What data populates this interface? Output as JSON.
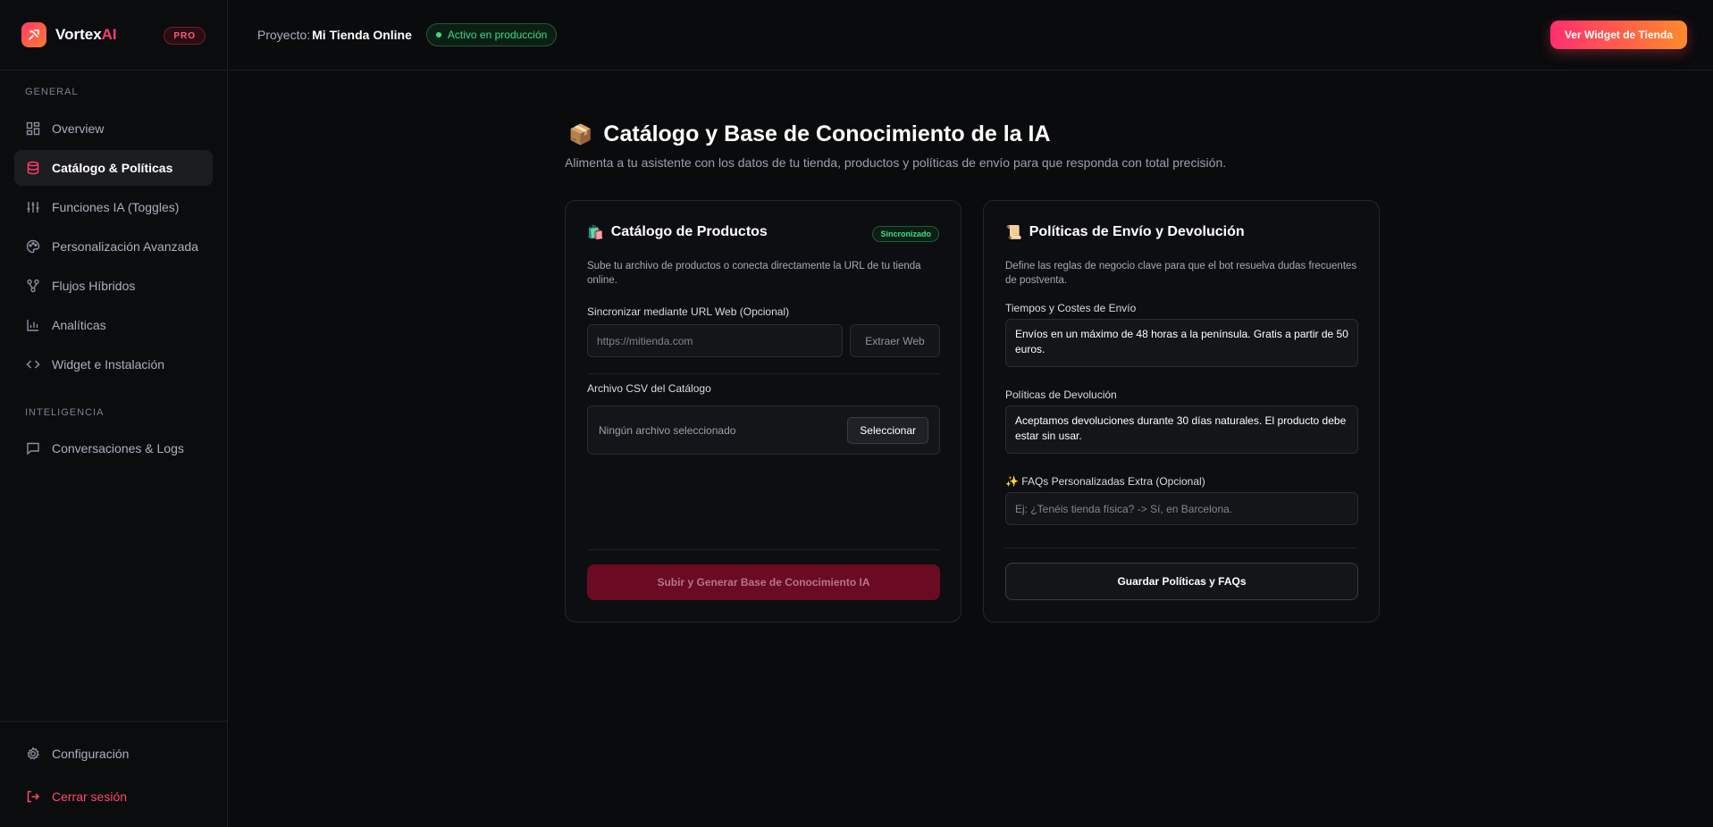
{
  "brand": {
    "name_main": "Vortex",
    "name_accent": "AI",
    "plan_badge": "PRO"
  },
  "sidebar": {
    "section_general": "GENERAL",
    "general_items": [
      {
        "label": "Overview",
        "icon": "grid-icon"
      },
      {
        "label": "Catálogo & Políticas",
        "icon": "database-icon"
      },
      {
        "label": "Funciones IA (Toggles)",
        "icon": "sliders-icon"
      },
      {
        "label": "Personalización Avanzada",
        "icon": "palette-icon"
      },
      {
        "label": "Flujos Híbridos",
        "icon": "flow-icon"
      },
      {
        "label": "Analíticas",
        "icon": "bar-chart-icon"
      },
      {
        "label": "Widget e Instalación",
        "icon": "code-icon"
      }
    ],
    "section_intel": "INTELIGENCIA",
    "intel_items": [
      {
        "label": "Conversaciones & Logs",
        "icon": "chat-icon"
      }
    ],
    "settings_label": "Configuración",
    "logout_label": "Cerrar sesión",
    "active_color": "#ff3d6b"
  },
  "topbar": {
    "project_label": "Proyecto:",
    "project_name": "Mi Tienda Online",
    "status": "Activo en producción",
    "cta": "Ver Widget de Tienda"
  },
  "page": {
    "title_emoji": "📦",
    "title": "Catálogo y Base de Conocimiento de la IA",
    "subtitle": "Alimenta a tu asistente con los datos de tu tienda, productos y políticas de envío para que responda con total precisión."
  },
  "catalog_card": {
    "emoji": "🛍️",
    "title": "Catálogo de Productos",
    "badge": "Sincronizado",
    "description": "Sube tu archivo de productos o conecta directamente la URL de tu tienda online.",
    "url_label": "Sincronizar mediante URL Web (Opcional)",
    "url_placeholder": "https://mitienda.com",
    "extract_button": "Extraer Web",
    "csv_label": "Archivo CSV del Catálogo",
    "file_status": "Ningún archivo seleccionado",
    "select_button": "Seleccionar",
    "submit_button": "Subir y Generar Base de Conocimiento IA"
  },
  "policies_card": {
    "emoji": "📜",
    "title": "Políticas de Envío y Devolución",
    "description": "Define las reglas de negocio clave para que el bot resuelva dudas frecuentes de postventa.",
    "shipping_label": "Tiempos y Costes de Envío",
    "shipping_value": "Envíos en un máximo de 48 horas a la península. Gratis a partir de 50 euros.",
    "returns_label": "Políticas de Devolución",
    "returns_value": "Aceptamos devoluciones durante 30 días naturales. El producto debe estar sin usar.",
    "faq_label": "✨ FAQs Personalizadas Extra (Opcional)",
    "faq_placeholder": "Ej: ¿Tenéis tienda física? -> Sí, en Barcelona.",
    "save_button": "Guardar Políticas y FAQs"
  }
}
